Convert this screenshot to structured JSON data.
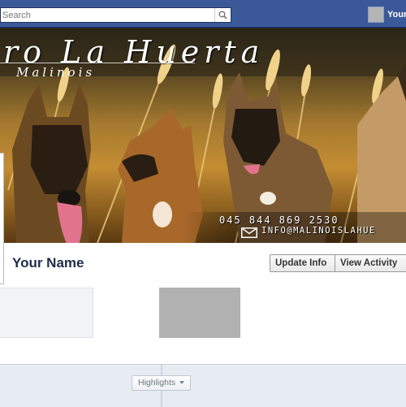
{
  "topbar": {
    "search_placeholder": "Search",
    "user_name": "Your"
  },
  "cover": {
    "title": "ro La Huerta",
    "subtitle": "Malinois",
    "phone": "045 844 869 2530",
    "email": "INFO@MALINOISLAHUE"
  },
  "profile": {
    "name": "Your Name",
    "update_info_label": "Update Info",
    "view_activity_label": "View Activity"
  },
  "timeline": {
    "highlights_label": "Highlights"
  },
  "colors": {
    "facebook_blue": "#3b5998",
    "name_color": "#1e2d4a"
  }
}
